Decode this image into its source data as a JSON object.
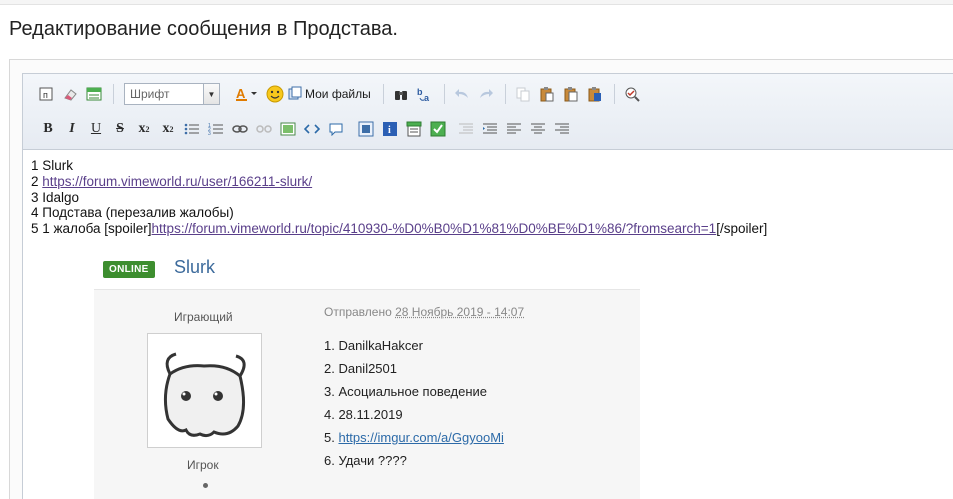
{
  "page": {
    "title": "Редактирование сообщения в Продстава."
  },
  "toolbar": {
    "font_combo": "Шрифт",
    "my_files": "Мои файлы"
  },
  "content": {
    "lines": [
      "1 Slurk",
      "2 ",
      "3 Idalgo",
      "4 Подстава (перезалив жалобы)",
      "5 1 жалоба [spoiler]"
    ],
    "line2_link": "https://forum.vimeworld.ru/user/166211-slurk/",
    "line5_link": "https://forum.vimeworld.ru/topic/410930-%D0%B0%D1%81%D0%BE%D1%86/?fromsearch=1",
    "line5_tail": "[/spoiler]"
  },
  "embedded": {
    "badge": "ONLINE",
    "username": "Slurk",
    "role": "Играющий",
    "rank": "Игрок",
    "posted_prefix": "Отправлено ",
    "posted_date": "28 Ноябрь 2019 - 14:07",
    "items": [
      "1. DanilkaHakcer",
      "2. Danil2501",
      "3. Асоциальное поведение",
      "4. 28.11.2019",
      "5. ",
      "6. Удачи ????"
    ],
    "item5_link": "https://imgur.com/a/GgyooMi"
  }
}
